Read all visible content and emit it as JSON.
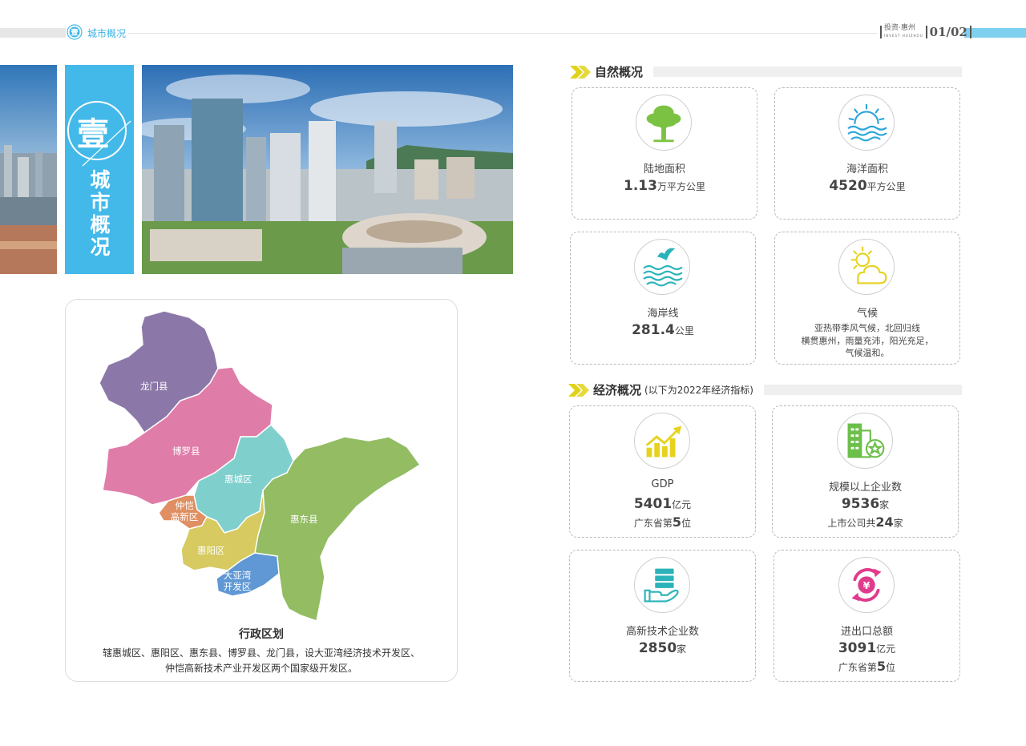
{
  "header": {
    "section_badge": "壹",
    "section_title": "城市概况",
    "slogan_cn": "投资·惠州",
    "slogan_en": "INVEST HUIZHOU",
    "page_numbers": "01/02"
  },
  "banner": {
    "number": "壹",
    "title": "城市概况"
  },
  "map": {
    "districts": {
      "longmen": "龙门县",
      "boluo": "博罗县",
      "huicheng": "惠城区",
      "zhongkai_1": "仲恺",
      "zhongkai_2": "高新区",
      "huiyang": "惠阳区",
      "dayawan_1": "大亚湾",
      "dayawan_2": "开发区",
      "huidong": "惠东县"
    },
    "colors": {
      "longmen": "#8b78a8",
      "boluo": "#e07ca8",
      "huicheng": "#7fcfcd",
      "zhongkai": "#e08f62",
      "huiyang": "#d6ca60",
      "dayawan": "#5f98d4",
      "huidong": "#93bc63"
    },
    "title": "行政区划",
    "desc_line1": "辖惠城区、惠阳区、惠东县、博罗县、龙门县，设大亚湾经济技术开发区、",
    "desc_line2": "仲恺高新技术产业开发区两个国家级开发区。"
  },
  "natural": {
    "title": "自然概况",
    "cards": [
      {
        "icon": "tree-icon",
        "label": "陆地面积",
        "value": "1.13",
        "unit": "万平方公里"
      },
      {
        "icon": "sea-sun-icon",
        "label": "海洋面积",
        "value": "4520",
        "unit": "平方公里"
      },
      {
        "icon": "coastline-bird-icon",
        "label": "海岸线",
        "value": "281.4",
        "unit": "公里"
      },
      {
        "icon": "sun-cloud-icon",
        "label": "气候",
        "desc1": "亚热带季风气候，北回归线",
        "desc2": "横贯惠州，雨量充沛，阳光充足，",
        "desc3": "气候温和。"
      }
    ]
  },
  "economy": {
    "title": "经济概况",
    "note": "(以下为2022年经济指标)",
    "cards": [
      {
        "icon": "growth-chart-icon",
        "label": "GDP",
        "value": "5401",
        "unit": "亿元",
        "sub_pre": "广东省第",
        "sub_num": "5",
        "sub_post": "位"
      },
      {
        "icon": "building-star-icon",
        "label": "规模以上企业数",
        "value": "9536",
        "unit": "家",
        "sub_pre": "上市公司共",
        "sub_num": "24",
        "sub_post": "家"
      },
      {
        "icon": "server-hand-icon",
        "label": "高新技术企业数",
        "value": "2850",
        "unit": "家"
      },
      {
        "icon": "yuan-exchange-icon",
        "label": "进出口总额",
        "value": "3091",
        "unit": "亿元",
        "sub_pre": "广东省第",
        "sub_num": "5",
        "sub_post": "位"
      }
    ]
  },
  "colors": {
    "accent_blue": "#43b9e9",
    "chevron_yellow": "#e0d21a",
    "green_icon": "#7cc242",
    "blue_icon": "#2ca6d9",
    "teal_icon": "#2bb3b9",
    "yellow_icon": "#e6d21f",
    "magenta_icon": "#e03b8c"
  }
}
